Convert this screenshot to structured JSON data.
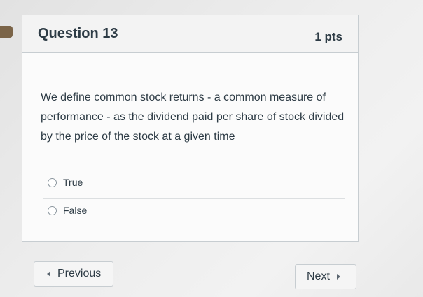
{
  "question": {
    "title": "Question 13",
    "points": "1 pts",
    "text": "We define common stock returns - a common measure of performance - as the dividend paid per share of stock divided by the price of the stock at a given time",
    "answers": [
      {
        "label": "True",
        "selected": false
      },
      {
        "label": "False",
        "selected": false
      }
    ]
  },
  "navigation": {
    "previous_label": "Previous",
    "next_label": "Next"
  },
  "colors": {
    "flag": "#7b6448",
    "text": "#2d3b45",
    "border": "#c7cdd1"
  }
}
